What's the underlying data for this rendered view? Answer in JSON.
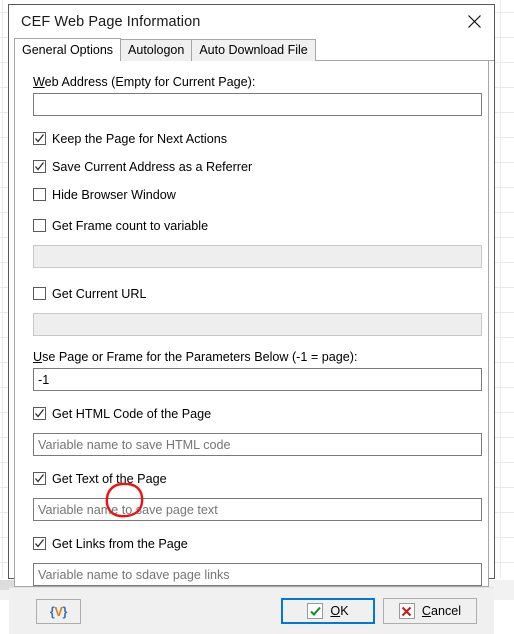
{
  "window": {
    "title": "CEF Web Page Information",
    "close_icon": "close-icon"
  },
  "tabs": [
    {
      "label": "General Options",
      "active": true
    },
    {
      "label": "Autologon",
      "active": false
    },
    {
      "label": "Auto Download File",
      "active": false
    }
  ],
  "form": {
    "web_address": {
      "label_accel": "W",
      "label_rest": "eb Address (Empty for Current Page):",
      "value": "",
      "placeholder": "",
      "enabled": true
    },
    "keep_page": {
      "label": "Keep the Page for Next Actions",
      "checked": true
    },
    "save_referrer": {
      "label": "Save Current Address as a Referrer",
      "checked": true
    },
    "hide_browser": {
      "label": "Hide Browser Window",
      "checked": false
    },
    "frame_count": {
      "label": "Get Frame count to variable",
      "checked": false,
      "value": "",
      "enabled": false
    },
    "current_url": {
      "label": "Get Current URL",
      "checked": false,
      "value": "",
      "enabled": false
    },
    "page_or_frame": {
      "label_accel": "U",
      "label_rest": "se Page or Frame for the Parameters Below (-1 = page):",
      "value": "-1",
      "enabled": true
    },
    "get_html": {
      "label": "Get HTML Code of the Page",
      "checked": true,
      "placeholder": "Variable name to save HTML code",
      "value": ""
    },
    "get_text": {
      "label": "Get Text of the Page",
      "checked": true,
      "placeholder": "Variable name to save page text",
      "value": ""
    },
    "get_links": {
      "label": "Get Links from the Page",
      "checked": true,
      "placeholder": "Variable name to sdave page links",
      "value": ""
    }
  },
  "footer": {
    "variable_button": {
      "brace_left": "{",
      "glyph": "V",
      "brace_right": "}"
    },
    "ok": {
      "accel": "O",
      "rest": "K",
      "icon": "green-check-icon"
    },
    "cancel": {
      "accel": "C",
      "rest": "ancel",
      "icon": "red-x-icon"
    }
  },
  "annotation": {
    "shape": "red-ellipse-circle",
    "color": "#ee1111",
    "targets_text": "sdave"
  }
}
